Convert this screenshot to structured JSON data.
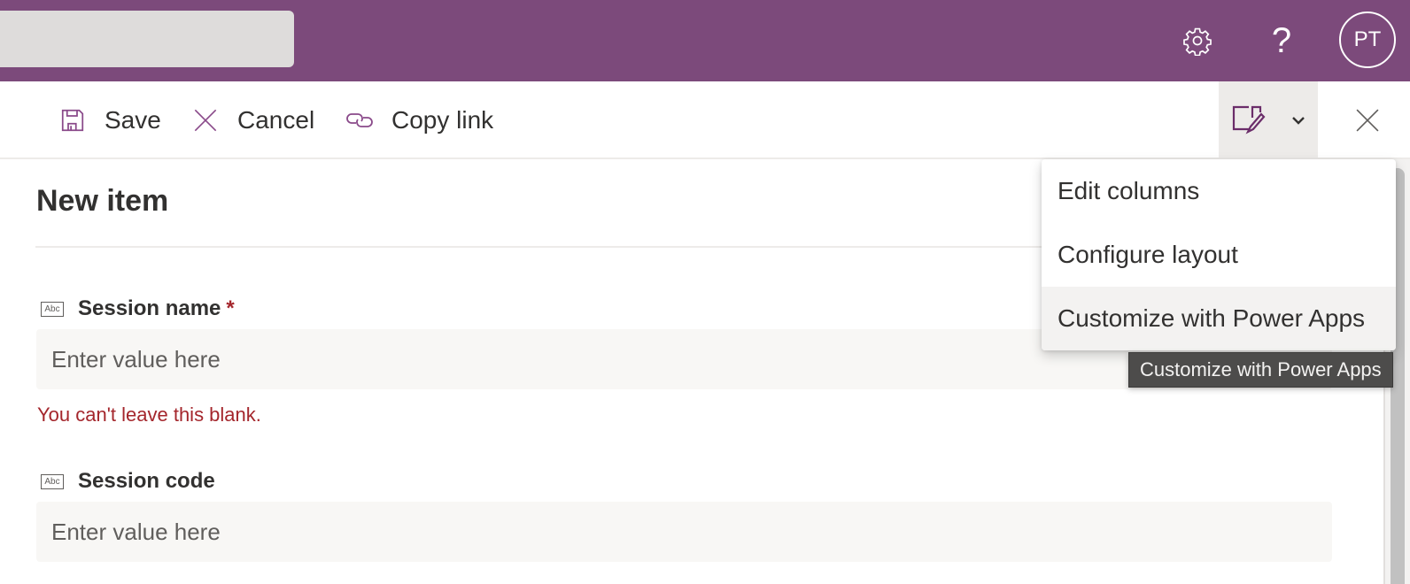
{
  "header": {
    "search_placeholder": "",
    "avatar_initials": "PT",
    "icons": {
      "settings": "gear-icon",
      "help": "help-icon"
    }
  },
  "commands": {
    "save_label": "Save",
    "cancel_label": "Cancel",
    "copy_link_label": "Copy link"
  },
  "form": {
    "title": "New item",
    "fields": [
      {
        "label": "Session name",
        "required_mark": "*",
        "type_icon": "Abc",
        "placeholder": "Enter value here",
        "value": "",
        "error": "You can't leave this blank."
      },
      {
        "label": "Session code",
        "type_icon": "Abc",
        "placeholder": "Enter value here",
        "value": ""
      }
    ]
  },
  "view_menu": {
    "items": [
      {
        "label": "Edit columns"
      },
      {
        "label": "Configure layout"
      },
      {
        "label": "Customize with Power Apps"
      }
    ],
    "hovered_index": 2,
    "tooltip": "Customize with Power Apps"
  },
  "colors": {
    "brand": "#7c4a7b",
    "error": "#a4262c",
    "icon_accent": "#8a4a8a"
  }
}
